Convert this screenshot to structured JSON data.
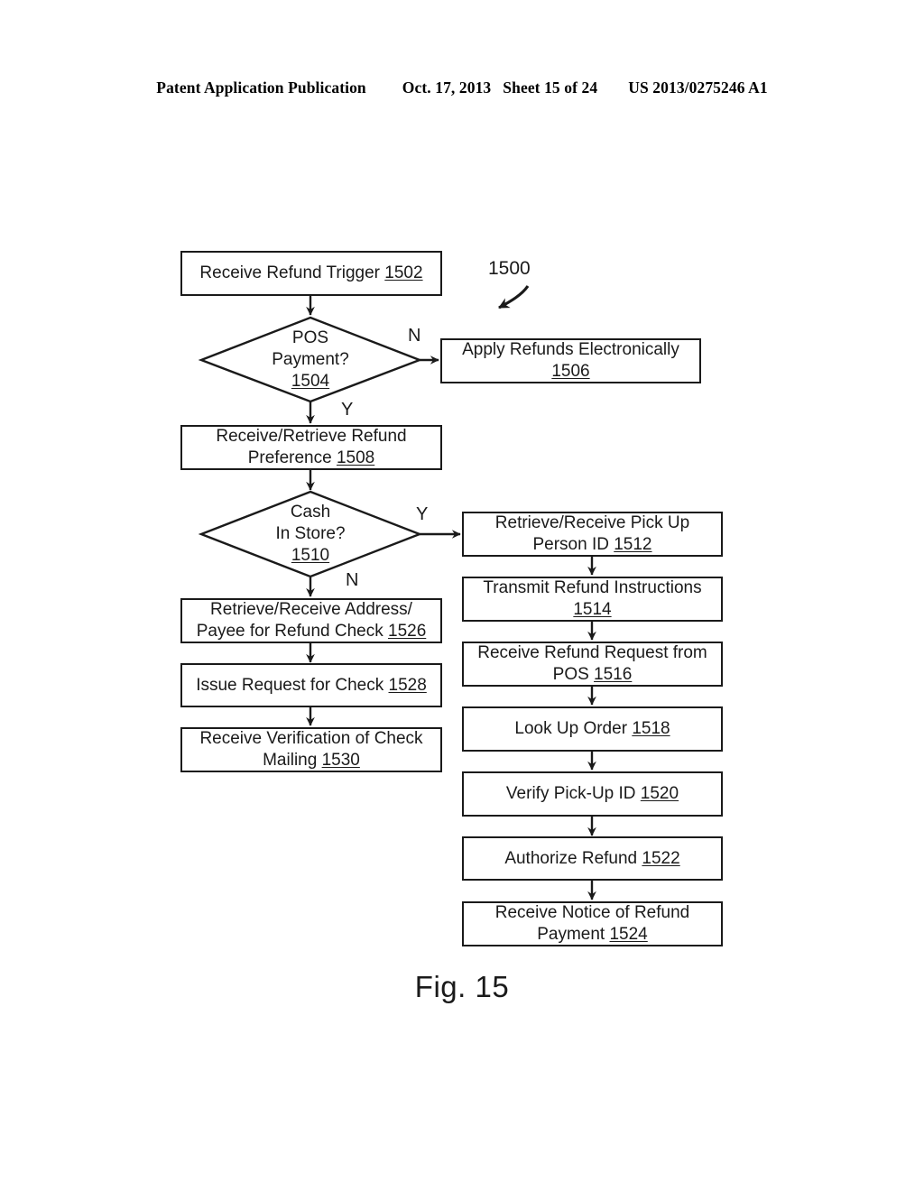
{
  "header": {
    "publication": "Patent Application Publication",
    "date": "Oct. 17, 2013",
    "sheet": "Sheet 15 of 24",
    "doc_number": "US 2013/0275246 A1"
  },
  "figure": {
    "caption": "Fig. 15",
    "callout": "1500"
  },
  "branches": {
    "pos_no": "N",
    "pos_yes": "Y",
    "cash_yes": "Y",
    "cash_no": "N"
  },
  "nodes": {
    "n1502": {
      "line1": "Receive Refund Trigger ",
      "ref": "1502"
    },
    "n1504": {
      "line1": "POS",
      "line2": "Payment?",
      "ref": "1504"
    },
    "n1506": {
      "line1": "Apply Refunds Electronically",
      "ref": "1506"
    },
    "n1508": {
      "line1": "Receive/Retrieve Refund",
      "line2": "Preference ",
      "ref": "1508"
    },
    "n1510": {
      "line1": "Cash",
      "line2": "In Store?",
      "ref": "1510"
    },
    "n1512": {
      "line1": "Retrieve/Receive Pick Up",
      "line2": "Person ID ",
      "ref": "1512"
    },
    "n1514": {
      "line1": "Transmit Refund Instructions",
      "ref": "1514"
    },
    "n1516": {
      "line1": "Receive Refund Request from",
      "line2": "POS ",
      "ref": "1516"
    },
    "n1518": {
      "line1": "Look Up Order ",
      "ref": "1518"
    },
    "n1520": {
      "line1": "Verify Pick-Up ID ",
      "ref": "1520"
    },
    "n1522": {
      "line1": "Authorize Refund ",
      "ref": "1522"
    },
    "n1524": {
      "line1": "Receive Notice of Refund",
      "line2": "Payment ",
      "ref": "1524"
    },
    "n1526": {
      "line1": "Retrieve/Receive Address/",
      "line2": "Payee for Refund Check ",
      "ref": "1526"
    },
    "n1528": {
      "line1": "Issue Request for Check ",
      "ref": "1528"
    },
    "n1530": {
      "line1": "Receive Verification of Check",
      "line2": "Mailing ",
      "ref": "1530"
    }
  },
  "colors": {
    "ink": "#1a1a1a",
    "paper": "#ffffff"
  }
}
